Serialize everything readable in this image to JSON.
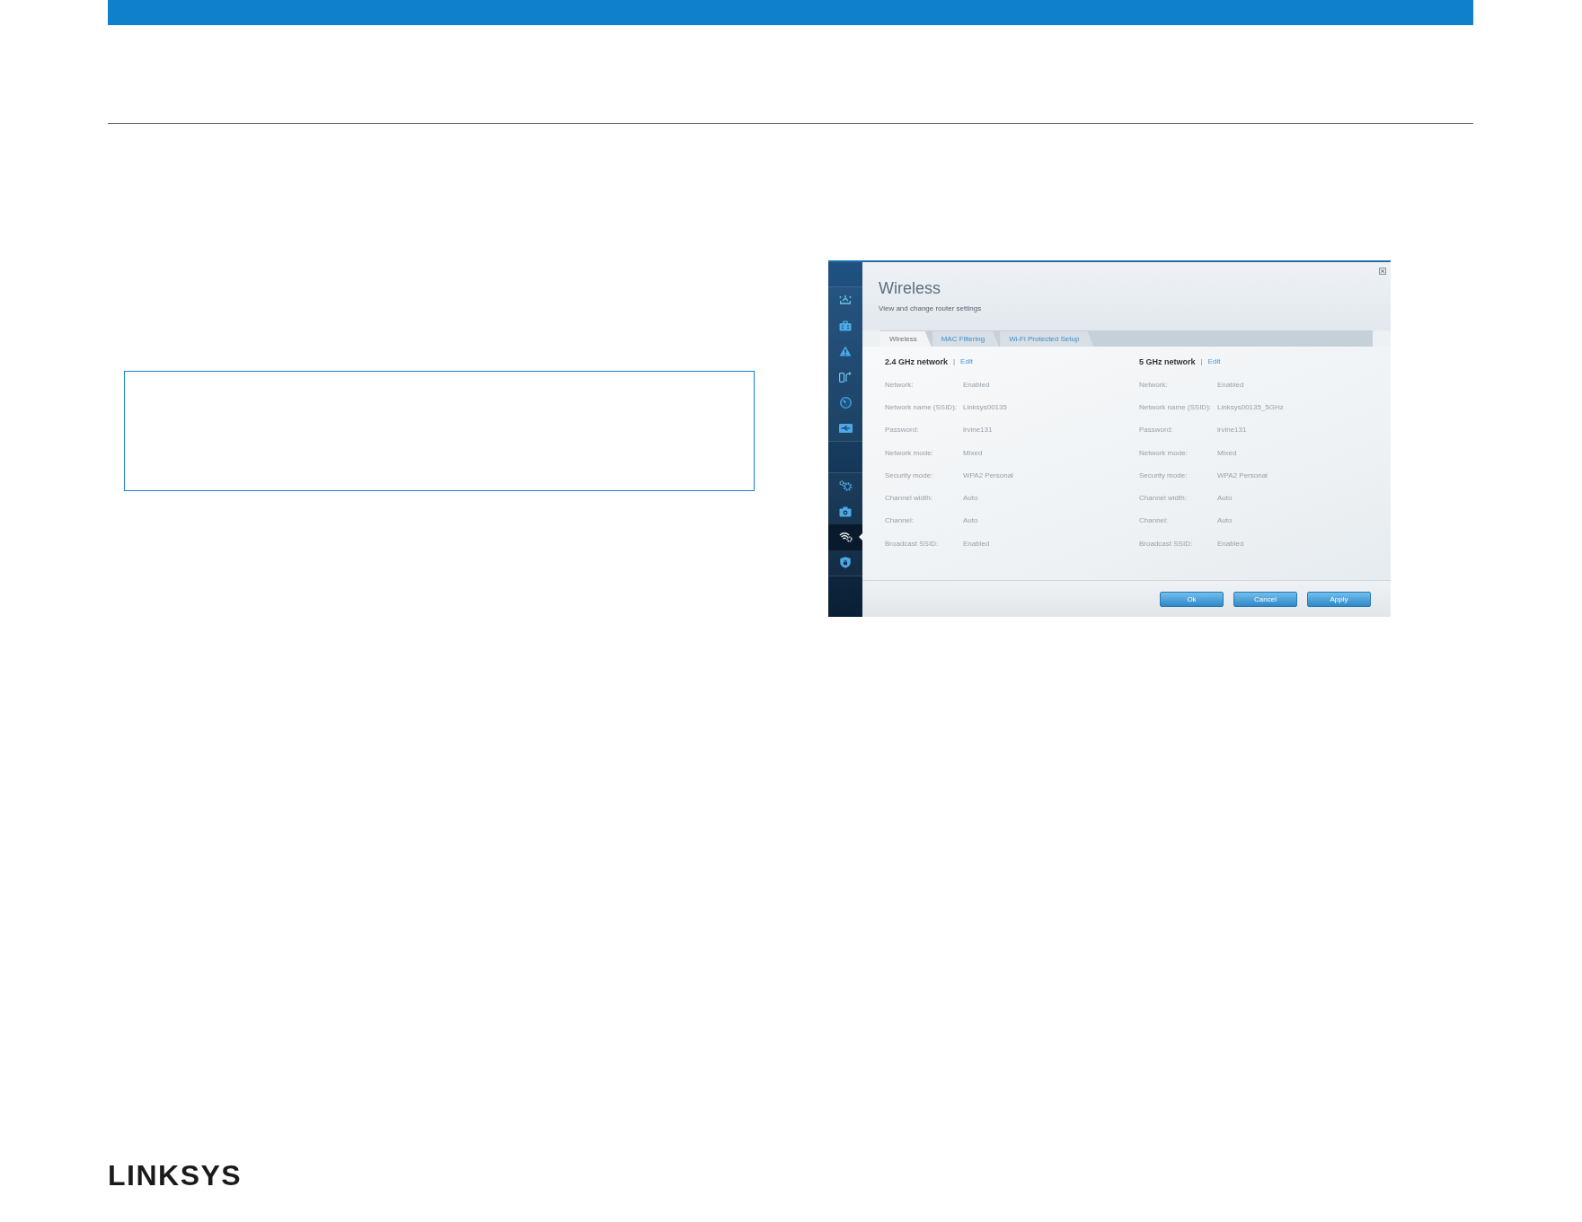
{
  "app_window": {
    "sidebar": {
      "groups": [
        {
          "items": [
            {
              "selected": false
            },
            {
              "selected": false
            },
            {
              "selected": false
            },
            {
              "selected": false
            },
            {
              "selected": false
            },
            {
              "selected": false
            }
          ]
        },
        {
          "items": [
            {
              "selected": false
            },
            {
              "selected": false
            },
            {
              "selected": true
            },
            {
              "selected": false
            }
          ]
        }
      ]
    },
    "title": "Wireless",
    "subtitle": "View and change router settings",
    "tabs": [
      {
        "label": "Wireless",
        "selected": true
      },
      {
        "label": "MAC Filtering",
        "selected": false
      },
      {
        "label": "Wi-Fi Protected Setup",
        "selected": false
      }
    ],
    "networks": [
      {
        "heading": "2.4 GHz network",
        "separator": "|",
        "link": "Edit",
        "rows": [
          {
            "label": "Network:",
            "value": "Enabled"
          },
          {
            "label": "Network name (SSID):",
            "value": "Linksys00135"
          },
          {
            "label": "Password:",
            "value": "irvine131"
          },
          {
            "label": "Network mode:",
            "value": "Mixed"
          },
          {
            "label": "Security mode:",
            "value": "WPA2 Personal"
          },
          {
            "label": "Channel width:",
            "value": "Auto"
          },
          {
            "label": "Channel:",
            "value": "Auto"
          },
          {
            "label": "Broadcast SSID:",
            "value": "Enabled"
          }
        ]
      },
      {
        "heading": "5 GHz network",
        "separator": "|",
        "link": "Edit",
        "rows": [
          {
            "label": "Network:",
            "value": "Enabled"
          },
          {
            "label": "Network name (SSID):",
            "value": "Linksys00135_5GHz"
          },
          {
            "label": "Password:",
            "value": "irvine131"
          },
          {
            "label": "Network mode:",
            "value": "Mixed"
          },
          {
            "label": "Security mode:",
            "value": "WPA2 Personal"
          },
          {
            "label": "Channel width:",
            "value": "Auto"
          },
          {
            "label": "Channel:",
            "value": "Auto"
          },
          {
            "label": "Broadcast SSID:",
            "value": "Enabled"
          }
        ]
      }
    ],
    "buttons": [
      "Ok",
      "Cancel",
      "Apply"
    ]
  },
  "footer": {
    "logo": "LINKSYS"
  }
}
